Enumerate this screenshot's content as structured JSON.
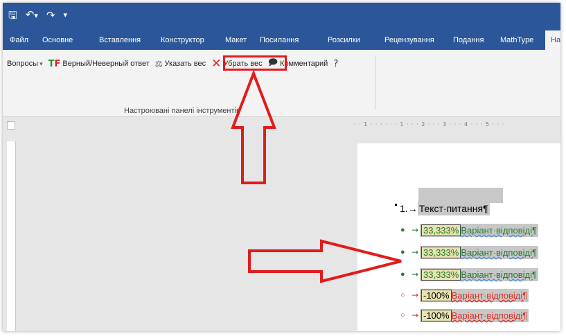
{
  "qat": {
    "save_icon": "save-icon",
    "undo_icon": "undo-icon",
    "redo_icon": "redo-icon",
    "customize_icon": "customize-qat-icon"
  },
  "tabs": [
    {
      "label": "Файл"
    },
    {
      "label": "Основне"
    },
    {
      "label": "Вставлення"
    },
    {
      "label": "Конструктор"
    },
    {
      "label": "Макет"
    },
    {
      "label": "Посилання"
    },
    {
      "label": "Розсилки"
    },
    {
      "label": "Рецензування"
    },
    {
      "label": "Подання"
    },
    {
      "label": "MathType"
    },
    {
      "label": "На"
    }
  ],
  "ribbon": {
    "questions_label": "Вопросы",
    "questions_dropdown": "▾",
    "true_false_label": "Верный/Неверный ответ",
    "set_weight_label": "Указать вес",
    "remove_weight_label": "Убрать вес",
    "comment_label": "Комментарий",
    "help_icon": "help-icon",
    "group_label": "Настроювані панелі інструментів"
  },
  "ruler": {
    "top_marks": "· · 1 · · · ·   · · 1 · · · 2 · · · 3 · · · 4 · · · 5 · · ·"
  },
  "document": {
    "question": {
      "number": "1.",
      "arrow": "→",
      "text": "Текст·питання¶"
    },
    "options": [
      {
        "bullet": "●",
        "arrow": "→",
        "weight": "33,333%",
        "text": "Варіант·відповіді¶",
        "correct": true
      },
      {
        "bullet": "●",
        "arrow": "→",
        "weight": "33,333%",
        "text": "Варіант·відповіді¶",
        "correct": true
      },
      {
        "bullet": "●",
        "arrow": "→",
        "weight": "33,333%",
        "text": "Варіант·відповіді¶",
        "correct": true
      },
      {
        "bullet": "○",
        "arrow": "→",
        "weight": "-100%",
        "text": "Варіант·відповіді¶",
        "correct": false
      },
      {
        "bullet": "○",
        "arrow": "→",
        "weight": "-100%",
        "text": "Варіант·відповіді¶",
        "correct": false
      }
    ]
  },
  "colors": {
    "title_bar": "#2b579a",
    "annotation": "#e21b1b",
    "correct": "#207b2a",
    "wrong": "#d93025"
  }
}
